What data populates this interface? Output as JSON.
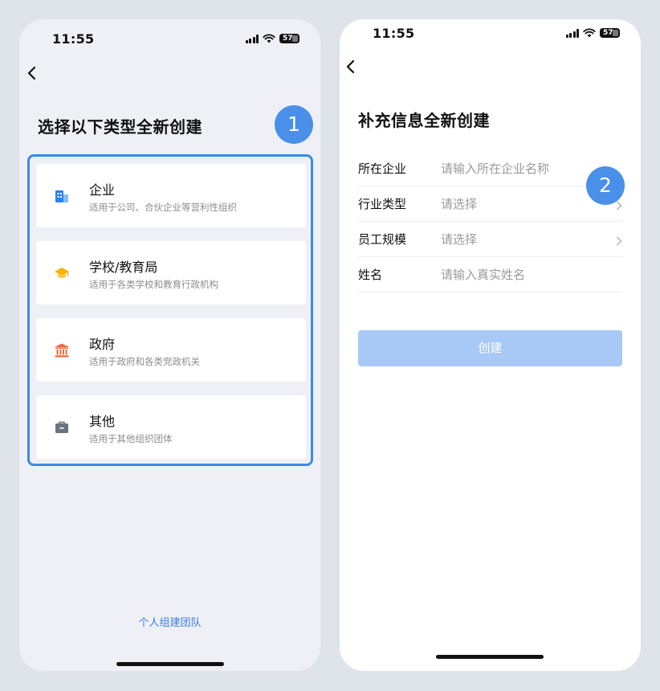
{
  "left_screen": {
    "status_time": "11:55",
    "battery": "57",
    "title": "选择以下类型全新创建",
    "step_badge": "1",
    "options": [
      {
        "name": "企业",
        "desc": "适用于公司、合伙企业等营利性组织",
        "icon": "building-icon",
        "color": "#2f80ed"
      },
      {
        "name": "学校/教育局",
        "desc": "适用于各类学校和教育行政机构",
        "icon": "graduation-cap-icon",
        "color": "#f5b400"
      },
      {
        "name": "政府",
        "desc": "适用于政府和各类党政机关",
        "icon": "government-building-icon",
        "color": "#ef6a3a"
      },
      {
        "name": "其他",
        "desc": "适用于其他组织团体",
        "icon": "briefcase-icon",
        "color": "#6b7280"
      }
    ],
    "bottom_link": "个人组建团队"
  },
  "right_screen": {
    "status_time": "11:55",
    "battery": "57",
    "title": "补充信息全新创建",
    "step_badge": "2",
    "fields": [
      {
        "label": "所在企业",
        "placeholder": "请输入所在企业名称",
        "has_chevron": false
      },
      {
        "label": "行业类型",
        "placeholder": "请选择",
        "has_chevron": true
      },
      {
        "label": "员工规模",
        "placeholder": "请选择",
        "has_chevron": true
      },
      {
        "label": "姓名",
        "placeholder": "请输入真实姓名",
        "has_chevron": false
      }
    ],
    "submit_label": "创建",
    "submit_color": "#a8c9f5"
  },
  "colors": {
    "accent": "#3c8ae6",
    "badge": "#4a8fe8",
    "link": "#3a7fe0"
  }
}
